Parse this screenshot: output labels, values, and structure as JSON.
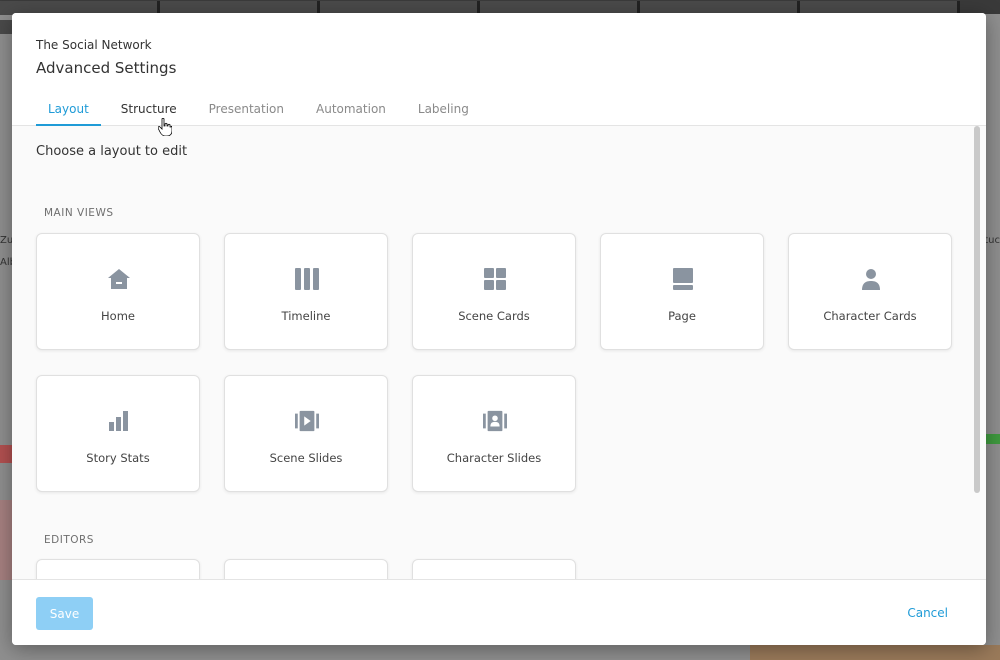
{
  "dialog": {
    "subtitle": "The Social Network",
    "title": "Advanced Settings"
  },
  "tabs": [
    {
      "label": "Layout",
      "active": true
    },
    {
      "label": "Structure",
      "active": false
    },
    {
      "label": "Presentation",
      "active": false
    },
    {
      "label": "Automation",
      "active": false
    },
    {
      "label": "Labeling",
      "active": false
    }
  ],
  "content": {
    "heading": "Choose a layout to edit",
    "main_views_label": "MAIN VIEWS",
    "editors_label": "EDITORS",
    "main_views": [
      {
        "label": "Home",
        "icon": "home-icon"
      },
      {
        "label": "Timeline",
        "icon": "timeline-icon"
      },
      {
        "label": "Scene Cards",
        "icon": "grid-icon"
      },
      {
        "label": "Page",
        "icon": "page-icon"
      },
      {
        "label": "Character Cards",
        "icon": "person-icon"
      },
      {
        "label": "Story Stats",
        "icon": "bar-chart-icon"
      },
      {
        "label": "Scene Slides",
        "icon": "slides-icon"
      },
      {
        "label": "Character Slides",
        "icon": "contact-slides-icon"
      }
    ]
  },
  "footer": {
    "save_label": "Save",
    "cancel_label": "Cancel"
  },
  "colors": {
    "accent": "#1f9bd7",
    "save_disabled": "#8ecff5",
    "icon": "#8a94a0"
  }
}
